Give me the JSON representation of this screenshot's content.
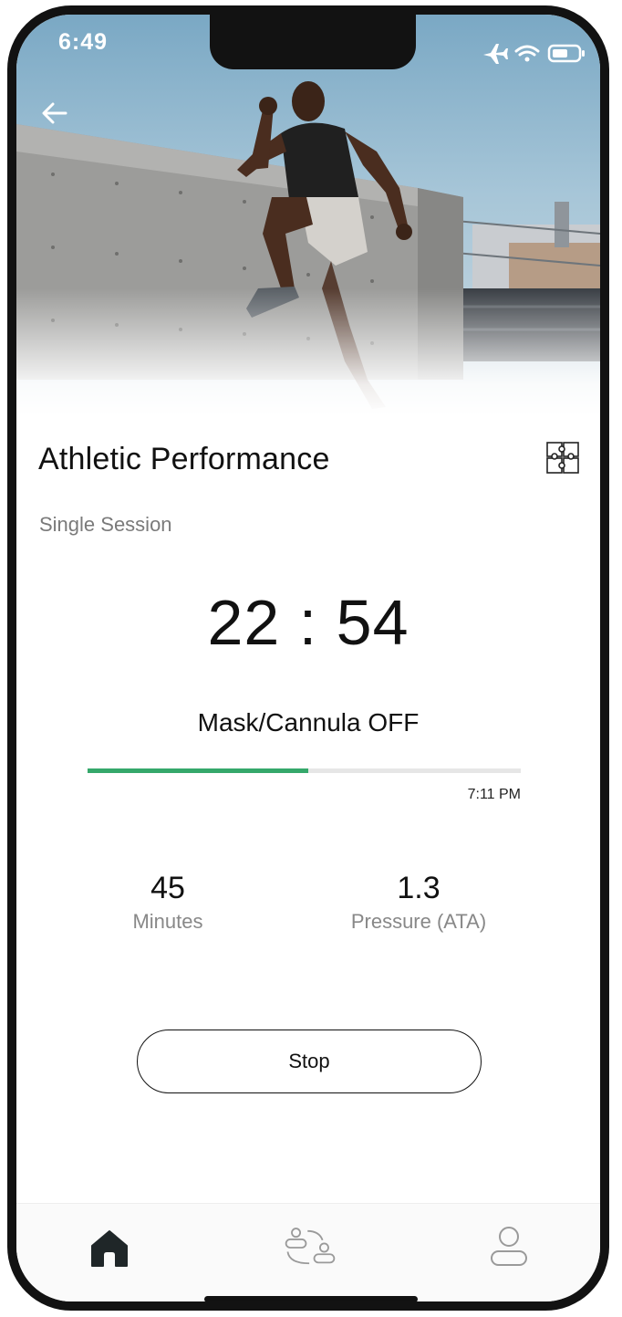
{
  "status_bar": {
    "time": "6:49",
    "icons": [
      "airplane-icon",
      "wifi-icon",
      "battery-icon"
    ]
  },
  "header": {
    "back_icon": "arrow-left-icon"
  },
  "session": {
    "title": "Athletic Performance",
    "subtitle": "Single Session",
    "timer": "22 : 54",
    "status": "Mask/Cannula OFF",
    "progress_fraction": 0.51,
    "end_time": "7:11 PM",
    "program_icon": "puzzle-icon"
  },
  "stats": [
    {
      "value": "45",
      "label": "Minutes"
    },
    {
      "value": "1.3",
      "label": "Pressure (ATA)"
    }
  ],
  "actions": {
    "stop_label": "Stop"
  },
  "tab_bar": {
    "items": [
      "home-icon",
      "sessions-icon",
      "profile-icon"
    ],
    "active": "home-icon"
  },
  "colors": {
    "progress": "#35a86b",
    "track": "#e6e6e6",
    "text": "#111111",
    "muted": "#7a7a7a"
  }
}
